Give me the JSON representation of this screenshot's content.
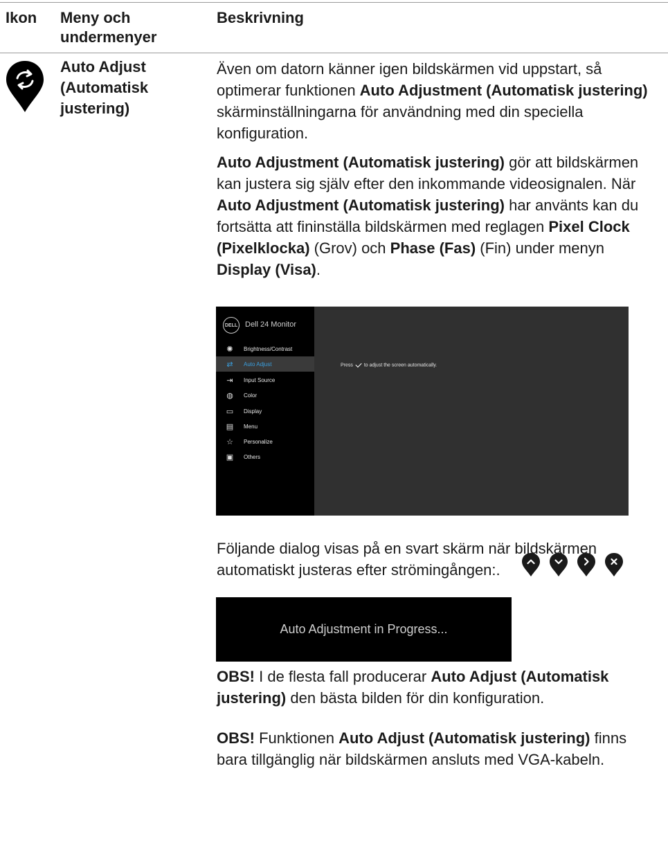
{
  "table": {
    "headers": {
      "icon": "Ikon",
      "menu": "Meny och undermenyer",
      "description": "Beskrivning"
    },
    "row": {
      "icon": "auto-adjust-icon",
      "menu_name": "Auto Adjust (Automatisk justering)",
      "paragraphs": {
        "p1": {
          "a": "Även om datorn känner igen bildskärmen vid uppstart, så optimerar funktionen ",
          "b": "Auto Adjustment (Automatisk justering)",
          "c": " skärminställningarna för användning med din speciella konfiguration."
        },
        "p2": {
          "a": "Auto Adjustment (Automatisk justering)",
          "b": " gör att bildskärmen kan justera sig själv efter den inkommande videosignalen. När ",
          "c": "Auto Adjustment (Automatisk justering)",
          "d": " har använts kan du fortsätta att fininställa bildskärmen med reglagen ",
          "e": "Pixel Clock (Pixelklocka)",
          "f": " (Grov) och ",
          "g": "Phase (Fas)",
          "h": " (Fin) under menyn ",
          "i": "Display (Visa)",
          "j": "."
        },
        "p3": "Följande dialog visas på en svart skärm när bildskärmen automatiskt justeras efter strömingången:.",
        "p4": {
          "a": "OBS!",
          "b": " I de flesta fall producerar ",
          "c": "Auto Adjust (Automatisk justering)",
          "d": " den bästa bilden för din konfiguration."
        },
        "p5": {
          "a": "OBS!",
          "b": " Funktionen ",
          "c": "Auto Adjust (Automatisk justering)",
          "d": " finns bara tillgänglig när bildskärmen ansluts med VGA-kabeln."
        }
      }
    }
  },
  "osd": {
    "logo": "DELL",
    "title": "Dell 24 Monitor",
    "items": [
      {
        "label": "Brightness/Contrast",
        "icon": "brightness-icon"
      },
      {
        "label": "Auto Adjust",
        "icon": "auto-adjust-icon",
        "active": true
      },
      {
        "label": "Input Source",
        "icon": "input-source-icon"
      },
      {
        "label": "Color",
        "icon": "color-palette-icon"
      },
      {
        "label": "Display",
        "icon": "display-icon"
      },
      {
        "label": "Menu",
        "icon": "menu-icon"
      },
      {
        "label": "Personalize",
        "icon": "star-icon"
      },
      {
        "label": "Others",
        "icon": "others-icon"
      }
    ],
    "message_before": "Press",
    "message_after": "to adjust the screen automatically.",
    "active_color": "#3aa0e0"
  },
  "buttons": [
    "up-arrow-icon",
    "down-arrow-icon",
    "right-arrow-icon",
    "close-icon"
  ],
  "progress_dialog": {
    "text": "Auto Adjustment in Progress..."
  }
}
